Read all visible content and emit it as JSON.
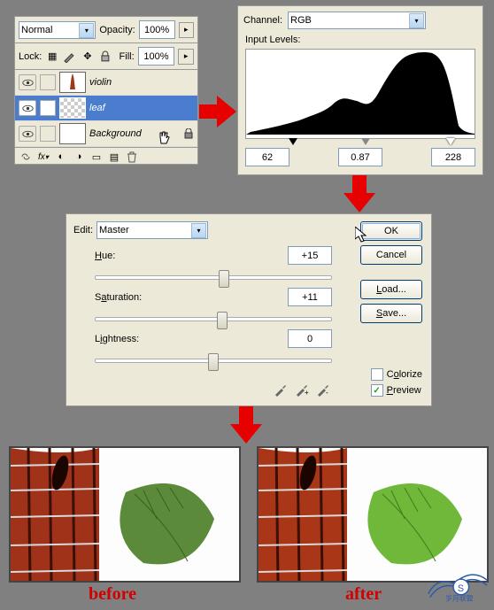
{
  "layers": {
    "blendmode": "Normal",
    "opacity_label": "Opacity:",
    "opacity_val": "100%",
    "lock_label": "Lock:",
    "fill_label": "Fill:",
    "fill_val": "100%",
    "rows": [
      {
        "name": "violin"
      },
      {
        "name": "leaf"
      },
      {
        "name": "Background"
      }
    ]
  },
  "levels": {
    "channel_label": "Channel:",
    "channel_val": "RGB",
    "input_label": "Input Levels:",
    "shadow": "62",
    "gamma": "0.87",
    "highlight": "228"
  },
  "hsl": {
    "edit_label": "Edit:",
    "edit_val": "Master",
    "hue_label": "Hue:",
    "hue_val": "+15",
    "sat_label": "Saturation:",
    "sat_val": "+11",
    "light_label": "Lightness:",
    "light_val": "0",
    "ok": "OK",
    "cancel": "Cancel",
    "load": "Load...",
    "save": "Save...",
    "colorize": "Colorize",
    "preview": "Preview"
  },
  "captions": {
    "before": "before",
    "after": "after"
  }
}
